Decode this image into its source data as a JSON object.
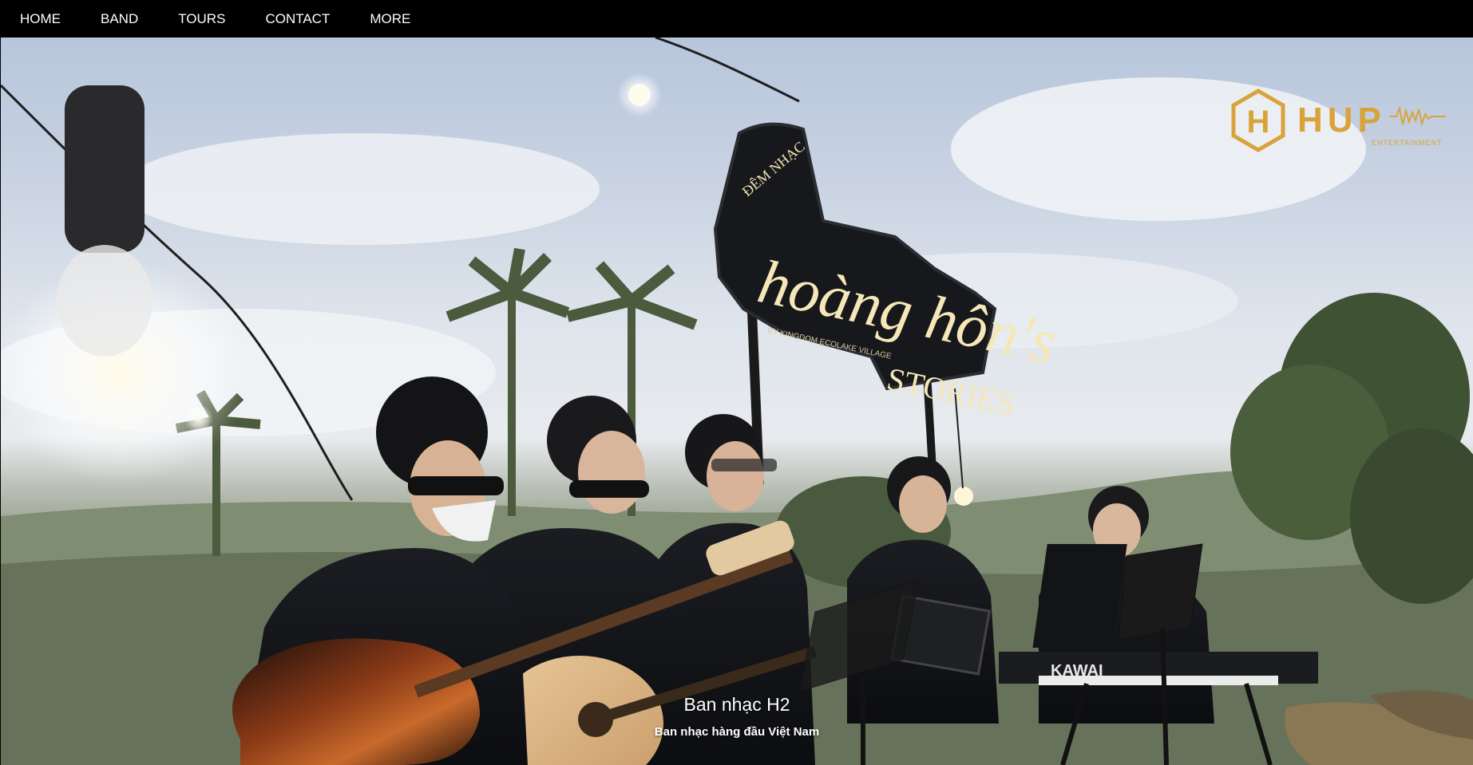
{
  "nav": {
    "items": [
      {
        "label": "HOME"
      },
      {
        "label": "BAND"
      },
      {
        "label": "TOURS"
      },
      {
        "label": "CONTACT"
      },
      {
        "label": "MORE"
      }
    ]
  },
  "hero": {
    "sign": {
      "line1": "ĐÊM NHẠC",
      "line2": "hoàng hôn's",
      "line3": "STORIES",
      "line4": "BY KINGDOM ECOLAKE VILLAGE"
    },
    "keyboard_brand": "KAWAI",
    "logo": {
      "text": "HUP",
      "sub": "ENTERTAINMENT"
    },
    "caption": {
      "title": "Ban nhạc H2",
      "subtitle": "Ban nhạc hàng đầu Việt Nam"
    }
  },
  "colors": {
    "nav_bg": "#000000",
    "nav_text": "#ffffff",
    "logo_gold": "#d9a33b",
    "caption_text": "#ffffff"
  }
}
